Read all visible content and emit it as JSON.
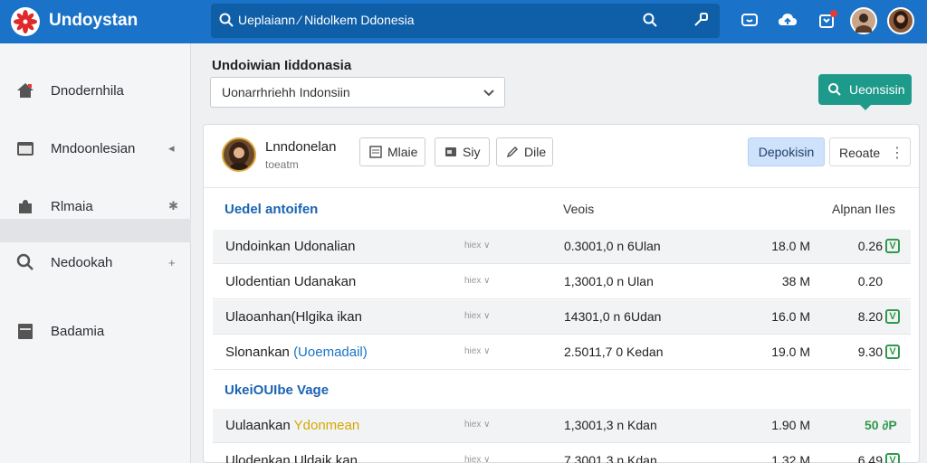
{
  "topbar": {
    "app_title": "Undoystan",
    "search_text": "Ueplaiann ⁄ Nidolkem Ddonesia",
    "icons": [
      "search-icon",
      "link-icon",
      "chat-icon",
      "upload-icon",
      "notification-icon"
    ]
  },
  "sidebar": {
    "items": [
      {
        "label": "Dnodernhila",
        "icon": "home-icon",
        "arrow": ""
      },
      {
        "label": "Mndoonlesian",
        "icon": "folder-icon",
        "arrow": "◂"
      },
      {
        "label": "Rlmaia",
        "icon": "puzzle-icon",
        "arrow": "✱"
      },
      {
        "label": "Nedookah",
        "icon": "search-icon",
        "arrow": "+"
      },
      {
        "label": "Badamia",
        "icon": "document-icon",
        "arrow": ""
      }
    ]
  },
  "header": {
    "title": "Undoiwian Iiddonasia",
    "select_value": "Uonarrhriehh Indonsiin",
    "primary_button": "Ueonsisin"
  },
  "card": {
    "user_name": "Lnndonelan",
    "user_sub": "toeatm",
    "buttons": {
      "btn1": "Mlaie",
      "btn2": "Siy",
      "btn3": "Dile",
      "btn4": "Depokisin",
      "btn5": "Reoate"
    },
    "section1_title": "Uedel antoifen",
    "columns": {
      "c2": "Veois",
      "c3": "Alpnan IIes"
    },
    "rows1": [
      {
        "name": "Undoinkan Udonalian",
        "tag": "hiex ∨",
        "value": "0.3001,0 n 6Ulan",
        "size": "18.0 M",
        "num": "0.26"
      },
      {
        "name": "Ulodentian Udanakan",
        "tag": "hiex ∨",
        "value": "1,3001,0 n Ulan",
        "size": "38 M",
        "num": "0.20"
      },
      {
        "name": "Ulaoanhan(Hlgika ikan",
        "tag": "hiex ∨",
        "value": "14301,0 n 6Udan",
        "size": "16.0 M",
        "num": "8.20"
      },
      {
        "name_pre": "Slonankan ",
        "name_hl": "(Uoemadail)",
        "tag": "hiex ∨",
        "value": "2.5011,7 0 Kedan",
        "size": "19.0 M",
        "num": "9.30"
      }
    ],
    "section2_title": "UkeiOUIbe Vage",
    "rows2": [
      {
        "name_pre": "Uulaankan ",
        "name_hl": "Ydonmean",
        "tag": "hiex ∨",
        "value": "1,3001,3 n Kdan",
        "size": "1.90 M",
        "status": "50 ∂P"
      },
      {
        "name": "Ulodenkan Uldaik kan",
        "tag": "hiex ∨",
        "value": "7,3001,3 n Kdan",
        "size": "1.32 M",
        "num": "6.49"
      }
    ]
  },
  "colors": {
    "topbar": "#1a73c8",
    "accent_teal": "#1e9a8a",
    "link_blue": "#1a63b3",
    "success_green": "#2e9a4c"
  }
}
